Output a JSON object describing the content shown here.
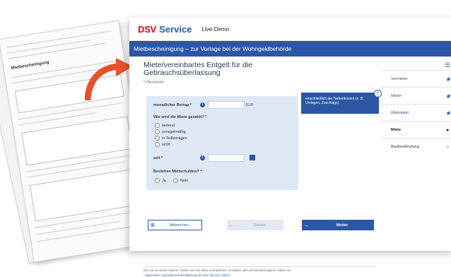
{
  "header": {
    "brand_a": "DSV",
    "brand_b": "Service",
    "demo_label": "Live-Demo"
  },
  "titlebar": {
    "title": "Mietbescheinigung – zur Vorlage bei der Wohngeldbehörde"
  },
  "form": {
    "heading": "Miete/vereinbartes Entgelt für die Gebrauchsüberlassung",
    "required_note": "* Pflichtfelder",
    "rent_label": "monatlicher Betrag *",
    "rent_value": "",
    "rent_unit": "EUR",
    "payment_question": "Wie wird die Miete gezahlt? *",
    "payment_options": [
      "laufend",
      "unregelmäßig",
      "in Teilbeträgen",
      "nicht"
    ],
    "since_label": "seit *",
    "since_value": "",
    "debts_question": "Bestehen Mietschulden? *",
    "debts_options": [
      "Ja",
      "Nein"
    ]
  },
  "tooltip": {
    "text": "einschließlich der Nebenkosten (z. B. Umlagen, Zuschläge)"
  },
  "buttons": {
    "cancel": "Abbrechen",
    "back": "Zurück",
    "next": "Weiter"
  },
  "footer": {
    "notice": "Dies ist ein Demo-System. Geben Sie hier keine vertraulichen, sensiblen oder personenbezogenen Daten ein.",
    "link": "Impressum und Datenschutzerklärung der DSV Service GmbH"
  },
  "sidebar": {
    "items": [
      {
        "label": "Vermieter",
        "state": "done"
      },
      {
        "label": "Mieter",
        "state": "done"
      },
      {
        "label": "Mietobjekt",
        "state": "done"
      },
      {
        "label": "Miete",
        "state": "current"
      },
      {
        "label": "Bankverbindung",
        "state": "open"
      }
    ]
  },
  "paper": {
    "title": "Mietbescheinigung"
  },
  "colors": {
    "brand_red": "#e2001a",
    "brand_blue": "#2b57a4",
    "arrow": "#e8502a"
  },
  "icons": [
    "info-icon",
    "calendar-icon",
    "close-icon",
    "cancel-icon",
    "arrow-left-icon",
    "arrow-right-icon",
    "list-icon"
  ]
}
